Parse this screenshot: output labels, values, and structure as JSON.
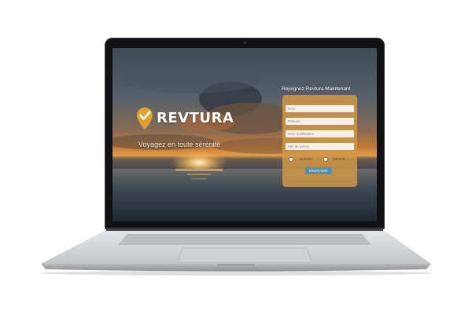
{
  "brand": {
    "name": "REVTURA",
    "tagline": "Voyagez en toute sérénité",
    "accent": "#e1a233"
  },
  "signup": {
    "title": "Rejoignez Revtura Maintenant",
    "fields": {
      "nom": "Nom",
      "prenom": "Prénom",
      "username": "Nom d'utilisateur",
      "password": "Mot de passe"
    },
    "gender": {
      "homme": "Homme",
      "femme": "Femme"
    },
    "submit_label": "ENVOYER"
  },
  "colors": {
    "panel": "#d09848",
    "button": "#4f8fb0",
    "laptop_body": "#c9cacc"
  }
}
